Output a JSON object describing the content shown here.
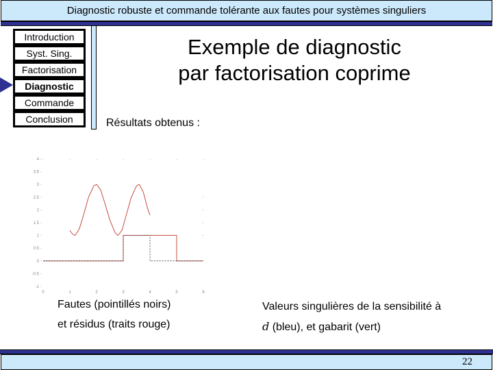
{
  "header": {
    "title": "Diagnostic robuste et commande tolérante aux fautes pour systèmes singuliers"
  },
  "nav": {
    "items": [
      {
        "label": "Introduction",
        "active": false
      },
      {
        "label": "Syst. Sing.",
        "active": false
      },
      {
        "label": "Factorisation",
        "active": false
      },
      {
        "label": "Diagnostic",
        "active": true
      },
      {
        "label": "Commande",
        "active": false
      },
      {
        "label": "Conclusion",
        "active": false
      }
    ],
    "current_indicator": "arrow-right-icon"
  },
  "slide": {
    "title_line1": "Exemple de diagnostic",
    "title_line2": "par factorisation coprime",
    "subtitle": "Résultats obtenus :",
    "caption_left_line1": "Fautes (pointillés noirs)",
    "caption_left_line2": "et résidus (traits rouge)",
    "caption_right_line1": "Valeurs singulières de la sensibilité à",
    "caption_right_symbol": "d",
    "caption_right_line2": " (bleu), et gabarit (vert)"
  },
  "footer": {
    "page_number": "22"
  },
  "colors": {
    "accent_dark": "#2e3192",
    "accent_light": "#cce8fb",
    "residual": "#c0392b",
    "fault": "#333333"
  },
  "chart_data": {
    "type": "line",
    "title": "",
    "xlabel": "",
    "ylabel": "",
    "xlim": [
      0,
      6
    ],
    "ylim": [
      -1,
      4
    ],
    "xticks": [
      "0",
      "1",
      "2",
      "3",
      "4",
      "5",
      "6"
    ],
    "yticks": [
      "-1",
      "-0.5",
      "0",
      "0.5",
      "1",
      "1.5",
      "2",
      "2.5",
      "3",
      "3.5",
      "4"
    ],
    "grid": false,
    "series": [
      {
        "name": "residual-curve",
        "style": "solid-red",
        "x": [
          1.0,
          1.1,
          1.2,
          1.35,
          1.5,
          1.7,
          1.9,
          2.0,
          2.15,
          2.3,
          2.5,
          2.7,
          2.8,
          2.95,
          3.1,
          3.3,
          3.5,
          3.6,
          3.75,
          3.9,
          4.0
        ],
        "y": [
          1.2,
          1.05,
          1.0,
          1.25,
          1.75,
          2.5,
          2.95,
          3.0,
          2.8,
          2.3,
          1.6,
          1.1,
          1.0,
          1.2,
          1.75,
          2.5,
          2.95,
          3.0,
          2.7,
          2.1,
          1.8
        ]
      },
      {
        "name": "residual-step",
        "style": "solid-red",
        "x": [
          0,
          3,
          3,
          4,
          4,
          5,
          5,
          6
        ],
        "y": [
          0,
          0,
          1,
          1,
          1,
          1,
          0,
          0
        ]
      },
      {
        "name": "fault",
        "style": "dashed-black",
        "x": [
          0,
          3,
          3,
          4,
          4,
          5,
          5,
          6
        ],
        "y": [
          0,
          0,
          1,
          1,
          0,
          0,
          0,
          0
        ]
      }
    ]
  }
}
